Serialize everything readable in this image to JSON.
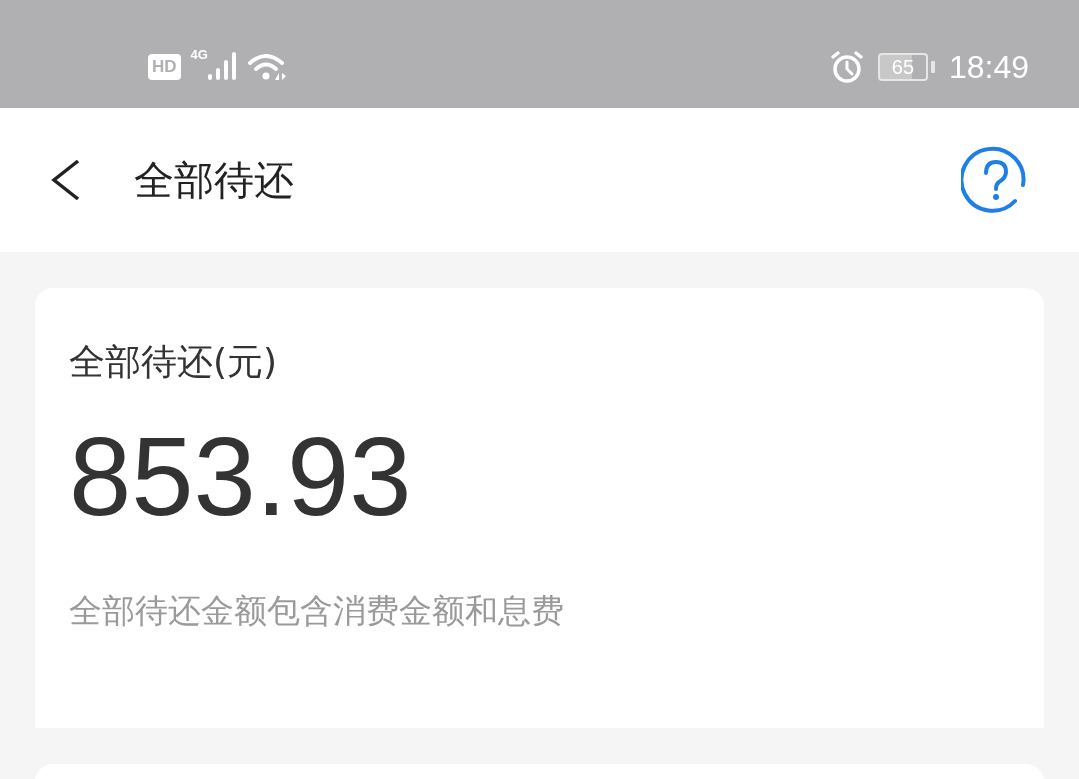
{
  "status_bar": {
    "hd": "HD",
    "network": "4G",
    "battery": "65",
    "time": "18:49"
  },
  "header": {
    "title": "全部待还"
  },
  "summary": {
    "label": "全部待还(元)",
    "amount": "853.93",
    "note": "全部待还金额包含消费金额和息费"
  }
}
